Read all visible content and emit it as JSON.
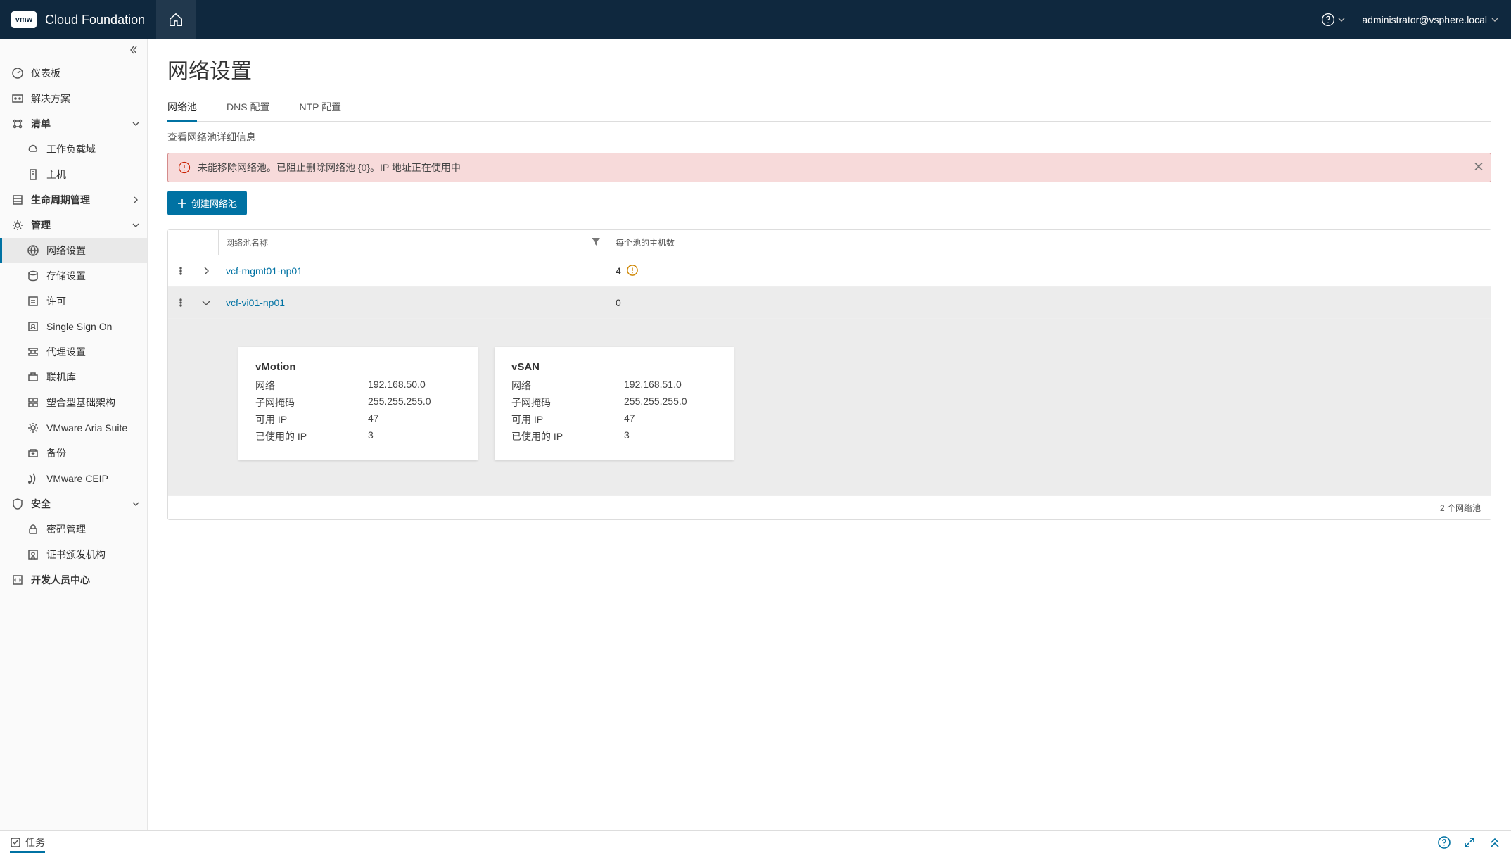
{
  "topbar": {
    "logo_text": "vmw",
    "product": "Cloud Foundation",
    "user": "administrator@vsphere.local"
  },
  "sidebar": {
    "items": [
      {
        "id": "dashboard",
        "label": "仪表板",
        "level": 1,
        "section": false,
        "chev": null
      },
      {
        "id": "solutions",
        "label": "解决方案",
        "level": 1,
        "section": false,
        "chev": null
      },
      {
        "id": "inventory",
        "label": "清单",
        "level": 1,
        "section": true,
        "chev": "down"
      },
      {
        "id": "workload",
        "label": "工作负载域",
        "level": 2,
        "section": false,
        "chev": null
      },
      {
        "id": "hosts",
        "label": "主机",
        "level": 2,
        "section": false,
        "chev": null
      },
      {
        "id": "lcm",
        "label": "生命周期管理",
        "level": 1,
        "section": true,
        "chev": "right"
      },
      {
        "id": "admin",
        "label": "管理",
        "level": 1,
        "section": true,
        "chev": "down"
      },
      {
        "id": "network",
        "label": "网络设置",
        "level": 2,
        "section": false,
        "chev": null,
        "active": true
      },
      {
        "id": "storage",
        "label": "存储设置",
        "level": 2,
        "section": false,
        "chev": null
      },
      {
        "id": "license",
        "label": "许可",
        "level": 2,
        "section": false,
        "chev": null
      },
      {
        "id": "sso",
        "label": "Single Sign On",
        "level": 2,
        "section": false,
        "chev": null
      },
      {
        "id": "proxy",
        "label": "代理设置",
        "level": 2,
        "section": false,
        "chev": null
      },
      {
        "id": "onlinelib",
        "label": "联机库",
        "level": 2,
        "section": false,
        "chev": null
      },
      {
        "id": "composable",
        "label": "塑合型基础架构",
        "level": 2,
        "section": false,
        "chev": null
      },
      {
        "id": "aria",
        "label": "VMware Aria Suite",
        "level": 2,
        "section": false,
        "chev": null
      },
      {
        "id": "backup",
        "label": "备份",
        "level": 2,
        "section": false,
        "chev": null
      },
      {
        "id": "ceip",
        "label": "VMware CEIP",
        "level": 2,
        "section": false,
        "chev": null
      },
      {
        "id": "security",
        "label": "安全",
        "level": 1,
        "section": true,
        "chev": "down"
      },
      {
        "id": "pwdmgmt",
        "label": "密码管理",
        "level": 2,
        "section": false,
        "chev": null
      },
      {
        "id": "certs",
        "label": "证书颁发机构",
        "level": 2,
        "section": false,
        "chev": null
      },
      {
        "id": "devcenter",
        "label": "开发人员中心",
        "level": 1,
        "section": true,
        "chev": null
      }
    ]
  },
  "page": {
    "title": "网络设置",
    "tabs": [
      {
        "id": "pool",
        "label": "网络池",
        "active": true
      },
      {
        "id": "dns",
        "label": "DNS 配置",
        "active": false
      },
      {
        "id": "ntp",
        "label": "NTP 配置",
        "active": false
      }
    ],
    "subtext": "查看网络池详细信息",
    "alert": "未能移除网络池。已阻止删除网络池 {0}。IP 地址正在使用中",
    "create_btn": "创建网络池",
    "columns": {
      "name": "网络池名称",
      "hosts": "每个池的主机数"
    },
    "rows": [
      {
        "name": "vcf-mgmt01-np01",
        "hosts": "4",
        "expanded": false,
        "warn": true
      },
      {
        "name": "vcf-vi01-np01",
        "hosts": "0",
        "expanded": true,
        "warn": false
      }
    ],
    "detail_labels": {
      "network": "网络",
      "subnet": "子网掩码",
      "avail": "可用 IP",
      "used": "已使用的 IP"
    },
    "details": [
      {
        "title": "vMotion",
        "network": "192.168.50.0",
        "subnet": "255.255.255.0",
        "avail": "47",
        "used": "3"
      },
      {
        "title": "vSAN",
        "network": "192.168.51.0",
        "subnet": "255.255.255.0",
        "avail": "47",
        "used": "3"
      }
    ],
    "footer": "2 个网络池"
  },
  "bottombar": {
    "tasks": "任务"
  }
}
